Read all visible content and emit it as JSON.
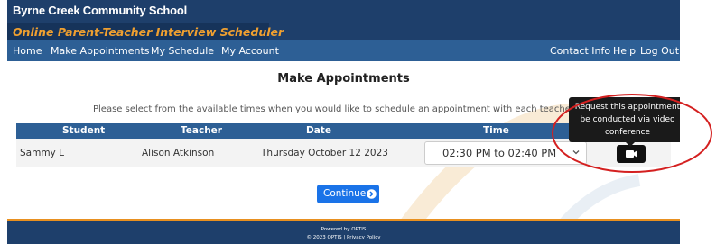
{
  "header": {
    "school_name": "Byrne Creek Community School",
    "app_name": "Online Parent-Teacher Interview Scheduler"
  },
  "nav": {
    "left": [
      "Home",
      "Make Appointments",
      "My Schedule",
      "My Account"
    ],
    "right": [
      "Contact Info",
      "Help",
      "Log Out"
    ]
  },
  "main": {
    "title": "Make Appointments",
    "instructions": "Please select from the available times when you would like to schedule an appointment with each teacher below and click"
  },
  "table": {
    "headers": [
      "Student",
      "Teacher",
      "Date",
      "Time"
    ],
    "rows": [
      {
        "student": "Sammy L",
        "teacher": "Alison Atkinson",
        "date": "Thursday October 12 2023",
        "time": "02:30 PM to 02:40 PM"
      }
    ]
  },
  "tooltip": {
    "text": "Request this appointment be conducted via video conference"
  },
  "continue_button": {
    "label": "Continue"
  },
  "footer": {
    "powered": "Powered by OPTIS",
    "copyright": "© 2023 OPTIS",
    "separator": "|",
    "privacy": "Privacy Policy"
  },
  "icons": {
    "video": "video-camera-icon",
    "continue": "arrow-circle-right-icon",
    "select": "chevron-down-icon"
  },
  "colors": {
    "header_dark": "#1e3f6b",
    "nav_blue": "#2d5f95",
    "app_name_orange": "#f0a030",
    "continue_blue": "#1a73e8",
    "footer_orange": "#e89020",
    "annotation_red": "#d42020"
  }
}
